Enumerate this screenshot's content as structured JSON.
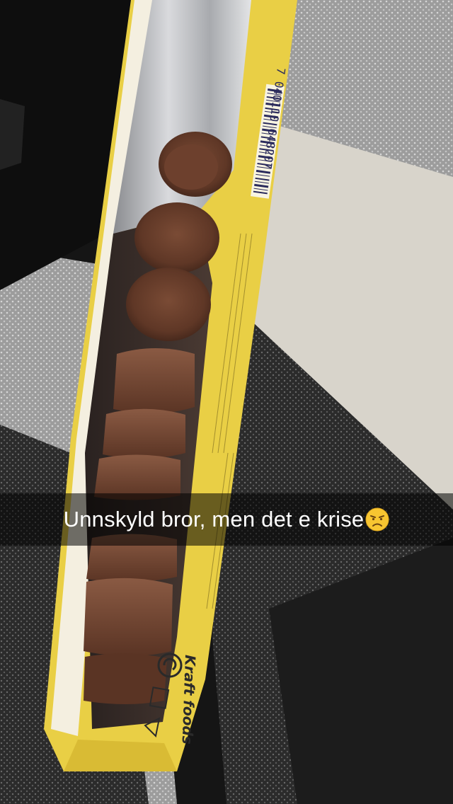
{
  "caption": {
    "text": "Unnskyld bror, men det e krise",
    "emoji": "disappointed-face-icon"
  },
  "package": {
    "barcode_number": "7 040110 648207",
    "brand": "Kraft foods"
  },
  "colors": {
    "wrapper_yellow": "#e8c83a",
    "chocolate": "#6b3f2a",
    "caption_bg": "rgba(0,0,0,0.55)",
    "caption_text": "#ffffff",
    "emoji_yellow": "#f7c531"
  }
}
